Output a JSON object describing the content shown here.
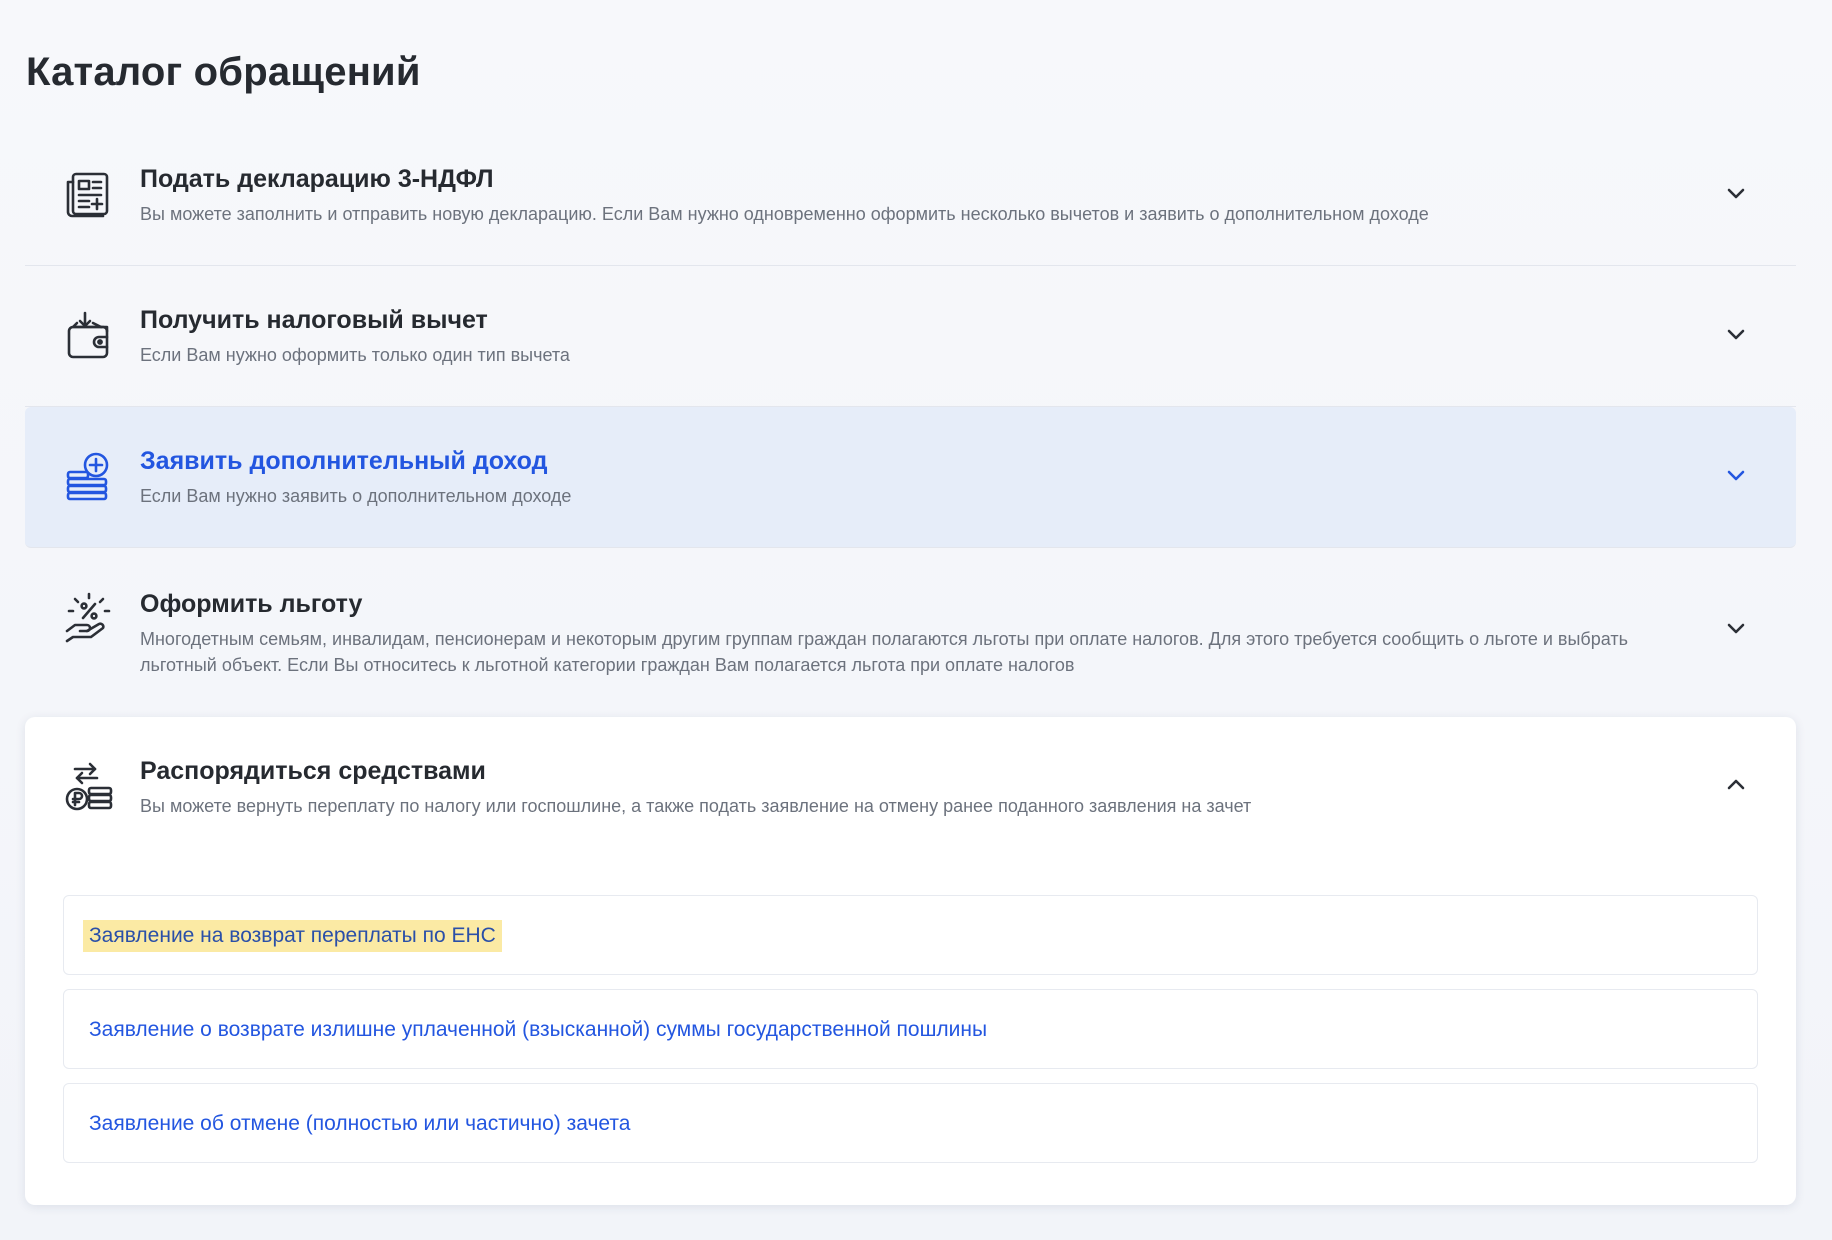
{
  "page": {
    "title": "Каталог обращений"
  },
  "catalog": {
    "items": [
      {
        "title": "Подать декларацию 3-НДФЛ",
        "description": "Вы можете заполнить и отправить новую декларацию. Если Вам нужно одновременно оформить несколько вычетов и заявить о дополнительном доходе",
        "icon": "declaration-document-icon",
        "state": "collapsed"
      },
      {
        "title": "Получить налоговый вычет",
        "description": "Если Вам нужно оформить только один тип вычета",
        "icon": "wallet-download-icon",
        "state": "collapsed"
      },
      {
        "title": "Заявить дополнительный доход",
        "description": "Если Вам нужно заявить о дополнительном доходе",
        "icon": "coins-plus-icon",
        "state": "collapsed-hovered"
      },
      {
        "title": "Оформить льготу",
        "description": "Многодетным семьям, инвалидам, пенсионерам и некоторым другим группам граждан полагаются льготы при оплате налогов. Для этого требуется сообщить о льготе и выбрать льготный объект. Если Вы относитесь к льготной категории граждан Вам полагается льгота при оплате налогов",
        "icon": "hand-percent-icon",
        "state": "collapsed"
      }
    ],
    "expanded": {
      "title": "Распорядиться средствами",
      "description": "Вы можете вернуть переплату по налогу или госпошлине, а также подать заявление на отмену ранее поданного заявления на зачет",
      "icon": "money-exchange-icon",
      "state": "expanded",
      "links": [
        {
          "label": "Заявление на возврат переплаты по ЕНС",
          "highlighted": true
        },
        {
          "label": "Заявление о возврате излишне уплаченной (взысканной) суммы государственной пошлины",
          "highlighted": false
        },
        {
          "label": "Заявление об отмене (полностью или частично) зачета",
          "highlighted": false
        }
      ]
    }
  },
  "colors": {
    "accent": "#2356e0",
    "active_row_bg": "#e6edf9",
    "highlight": "#fbeaa4",
    "text_primary": "#262a30",
    "text_secondary": "#6c727d"
  }
}
